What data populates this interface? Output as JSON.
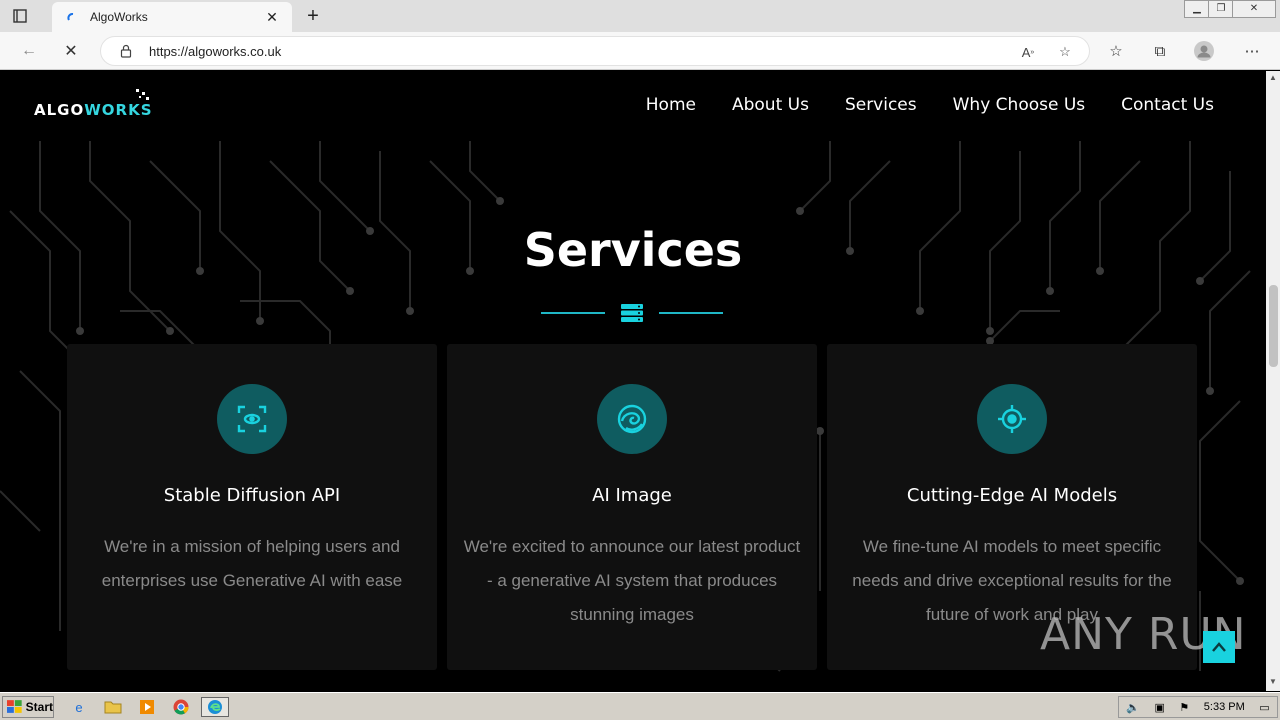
{
  "browser": {
    "tab_title": "AlgoWorks",
    "url": "https://algoworks.co.uk"
  },
  "site": {
    "logo_text_main": "ALGO",
    "logo_text_accent": "WORKS",
    "nav": [
      "Home",
      "About Us",
      "Services",
      "Why Choose Us",
      "Contact Us"
    ],
    "section_title": "Services",
    "cards": [
      {
        "icon": "face-scan-icon",
        "title": "Stable Diffusion API",
        "desc": "We're in a mission of helping users and enterprises use Generative AI with ease"
      },
      {
        "icon": "swirl-icon",
        "title": "AI Image",
        "desc": "We're excited to announce our latest product - a generative AI system that produces stunning images"
      },
      {
        "icon": "target-icon",
        "title": "Cutting-Edge AI Models",
        "desc": "We fine-tune AI models to meet specific needs and drive exceptional results for the future of work and play"
      }
    ],
    "watermark": "ANY RUN"
  },
  "taskbar": {
    "start_label": "Start",
    "clock": "5:33 PM"
  },
  "colors": {
    "accent": "#19d2df",
    "icon_bg": "#0f5c60",
    "card_bg": "#101010"
  }
}
